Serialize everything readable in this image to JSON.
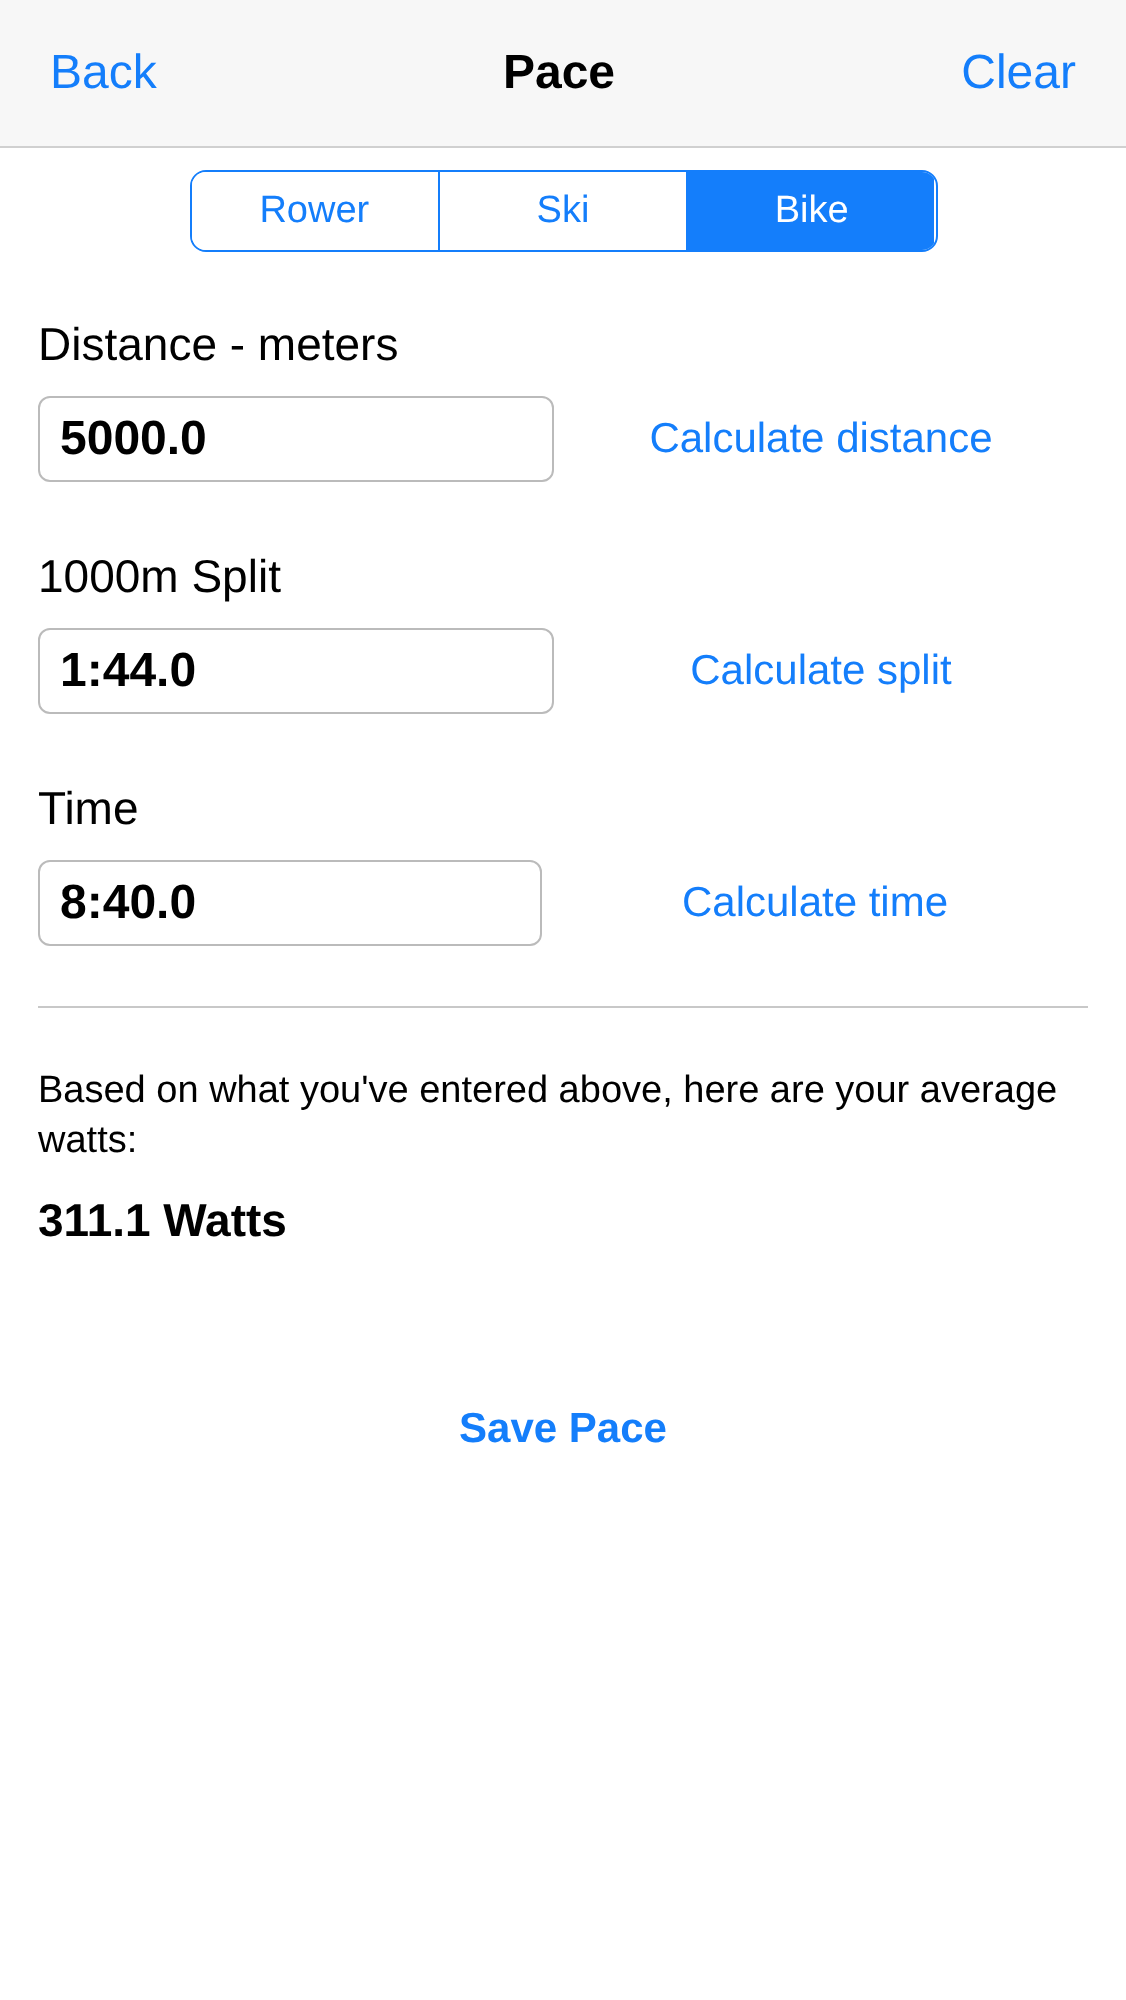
{
  "nav": {
    "back": "Back",
    "title": "Pace",
    "clear": "Clear"
  },
  "segments": [
    {
      "label": "Rower",
      "selected": false
    },
    {
      "label": "Ski",
      "selected": false
    },
    {
      "label": "Bike",
      "selected": true
    }
  ],
  "fields": [
    {
      "label": "Distance - meters",
      "value": "5000.0",
      "action": "Calculate distance"
    },
    {
      "label": "1000m Split",
      "value": "1:44.0",
      "action": "Calculate split"
    },
    {
      "label": "Time",
      "value": "8:40.0",
      "action": "Calculate time"
    }
  ],
  "result": {
    "description": "Based on what you've entered above, here are your average watts:",
    "value": "311.1 Watts"
  },
  "save_button": "Save Pace"
}
